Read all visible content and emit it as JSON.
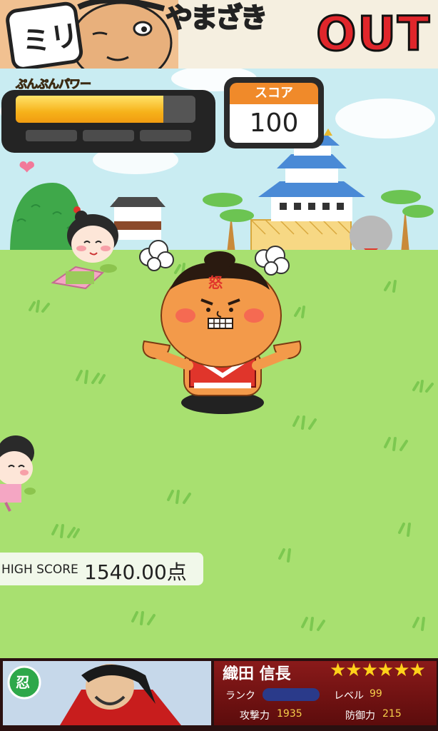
{
  "banner": {
    "logo_text": "やまざき",
    "logo_out": "OUT",
    "badge_text": "ミリ"
  },
  "hud": {
    "power_label": "ぷんぷんパワー",
    "power_level": 0.82,
    "power_segments_total": 3,
    "power_segments_filled": 0,
    "score_label": "スコア",
    "score_value": "100",
    "heart_icon": "heart-icon",
    "power_color": "#f6b21a",
    "score_header_color": "#f08a2a"
  },
  "game": {
    "main_character_mark": "怒",
    "high_score_label": "HIGH SCORE",
    "high_score_value": "1540.00点"
  },
  "card": {
    "name": "織田 信長",
    "stars": "★★★★★★",
    "rank_label": "ランク",
    "level_label": "レベル",
    "level_value": "99",
    "attack_label": "攻撃力",
    "attack_value": "1935",
    "defense_label": "防御力",
    "defense_value": "215",
    "badge_glyph": "忍"
  }
}
